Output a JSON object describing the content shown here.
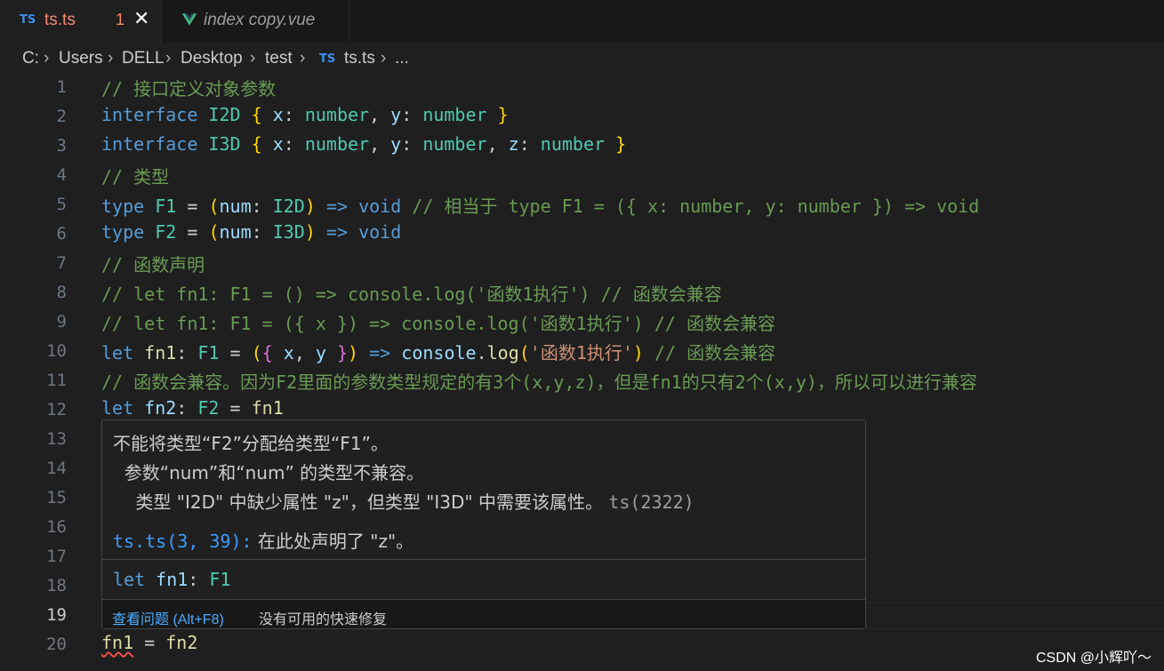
{
  "tabs": [
    {
      "icon": "TS",
      "name": "ts.ts",
      "problems": "1",
      "close": "✕"
    },
    {
      "icon": "vue-icon",
      "name": "index copy.vue"
    }
  ],
  "breadcrumb": {
    "drive": "C:",
    "users": "Users",
    "user": "DELL",
    "desktop": "Desktop",
    "folder": "test",
    "icon": "TS",
    "file": "ts.ts",
    "more": "...",
    "sep": "›"
  },
  "lines": [
    "1",
    "2",
    "3",
    "4",
    "5",
    "6",
    "7",
    "8",
    "9",
    "10",
    "11",
    "12",
    "13",
    "14",
    "15",
    "16",
    "17",
    "18",
    "19",
    "20"
  ],
  "code": {
    "l1": "// 接口定义对象参数",
    "l2": {
      "kw": "interface",
      "name": "I2D",
      "ob": "{",
      "x": "x",
      "c1": ":",
      "t1": "number",
      "comma": ",",
      "y": "y",
      "c2": ":",
      "t2": "number",
      "cb": "}"
    },
    "l3": {
      "kw": "interface",
      "name": "I3D",
      "ob": "{",
      "x": "x",
      "t1": "number",
      "y": "y",
      "t2": "number",
      "z": "z",
      "t3": "number",
      "cb": "}"
    },
    "l4": "// 类型",
    "l5": {
      "kw": "type",
      "name": "F1",
      "eq": "=",
      "op": "(",
      "param": "num",
      "colon": ":",
      "ptype": "I2D",
      "cp": ")",
      "arrow": "=>",
      "ret": "void",
      "comment": "// 相当于 type F1 = ({ x: number, y: number }) => void"
    },
    "l6": {
      "kw": "type",
      "name": "F2",
      "eq": "=",
      "op": "(",
      "param": "num",
      "colon": ":",
      "ptype": "I3D",
      "cp": ")",
      "arrow": "=>",
      "ret": "void"
    },
    "l7": "// 函数声明",
    "l8": "// let fn1: F1 = () => console.log('函数1执行') // 函数会兼容",
    "l9": "// let fn1: F1 = ({ x }) => console.log('函数1执行') // 函数会兼容",
    "l10": {
      "kw": "let",
      "name": "fn1",
      "colon": ":",
      "type": "F1",
      "eq": "=",
      "op": "(",
      "ob": "{",
      "x": "x",
      "comma": ",",
      "y": "y",
      "cb": "}",
      "cp": ")",
      "arrow": "=>",
      "obj": "console",
      "dot": ".",
      "fn": "log",
      "lp": "(",
      "str": "'函数1执行'",
      "rp": ")",
      "comment": "// 函数会兼容"
    },
    "l11": "// 函数会兼容。因为F2里面的参数类型规定的有3个(x,y,z)，但是fn1的只有2个(x,y)，所以可以进行兼容",
    "l12": {
      "kw": "let",
      "name": "fn2",
      "colon": ":",
      "type": "F2",
      "eq": "=",
      "val": "fn1"
    },
    "l20": {
      "name": "fn1",
      "eq": "=",
      "val": "fn2"
    }
  },
  "hover": {
    "line1": "不能将类型“F2”分配给类型“F1”。",
    "line2": "  参数“num”和“num” 的类型不兼容。",
    "line3": "    类型 \"I2D\" 中缺少属性 \"z\"，但类型 \"I3D\" 中需要该属性。",
    "code": "ts(2322)",
    "related_link": "ts.ts(3, 39):",
    "related_msg": " 在此处声明了 \"z\"。",
    "sig_kw": "let",
    "sig_name": "fn1",
    "sig_colon": ":",
    "sig_type": "F1",
    "view_problem": "查看问题 (Alt+F8)",
    "no_fix": "没有可用的快速修复"
  },
  "watermark": "CSDN @小辉吖～",
  "colors": {
    "keyword": "#569cd6",
    "type": "#4ec9b0",
    "variable": "#9cdcfe",
    "comment": "#6a9955",
    "function": "#dcdcaa",
    "string": "#ce9178",
    "bracket1": "#ffd700",
    "bracket2": "#da70d6",
    "bracket3": "#179fff",
    "error": "#f48771"
  }
}
